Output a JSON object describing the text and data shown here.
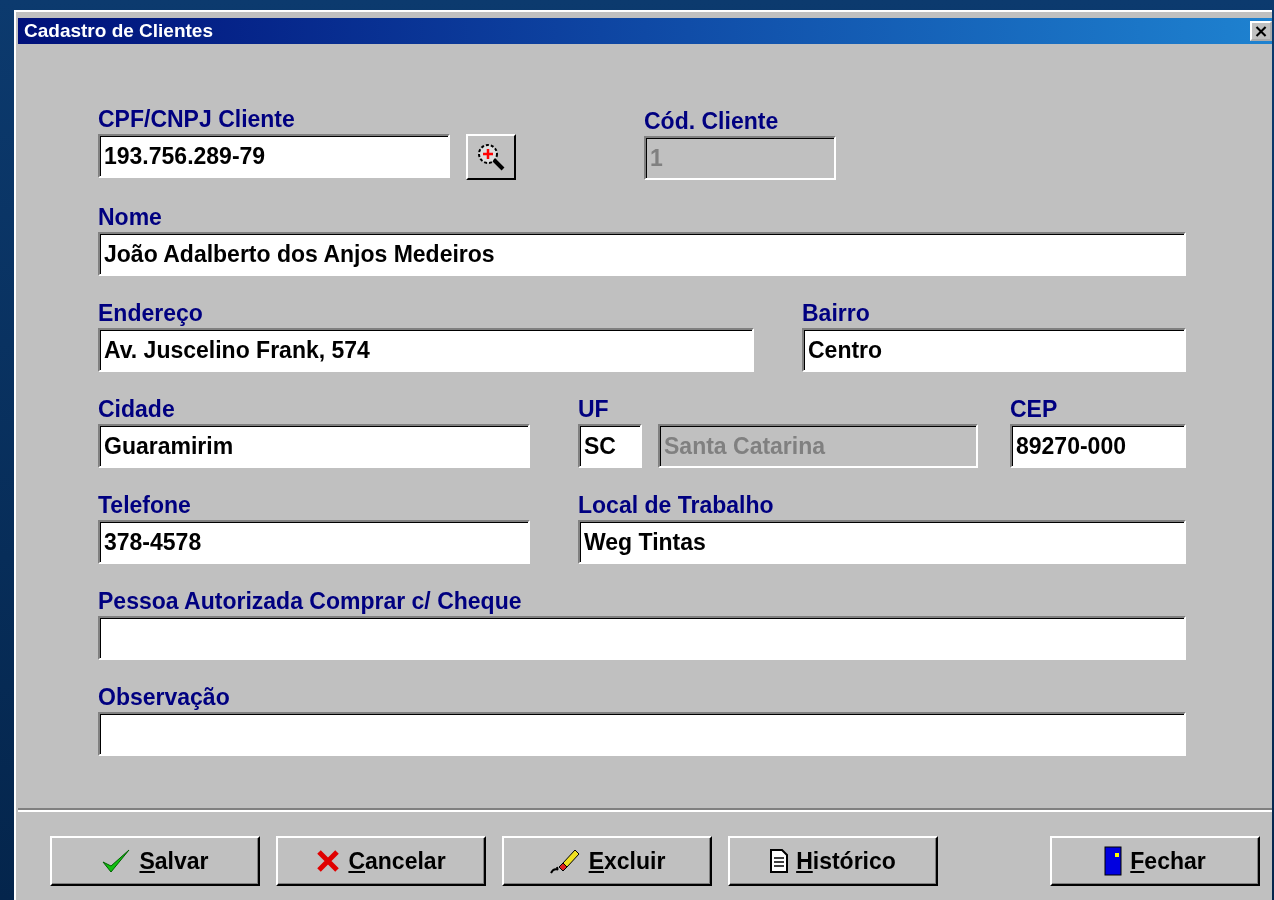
{
  "window": {
    "title": "Cadastro de Clientes",
    "close": "×"
  },
  "rows": [
    [
      {
        "label": "CPF/CNPJ Cliente",
        "value": "193.756.289-79",
        "disabled": false,
        "search_button": true
      },
      {
        "label": "Cód. Cliente",
        "value": "1",
        "disabled": true
      }
    ],
    [
      {
        "label": "Nome",
        "value": "João Adalberto dos Anjos Medeiros",
        "disabled": false
      }
    ],
    [
      {
        "label": "Endereço",
        "value": "Av. Juscelino Frank, 574",
        "disabled": false
      },
      {
        "label": "Bairro",
        "value": "Centro",
        "disabled": false
      }
    ],
    [
      {
        "label": "Cidade",
        "value": "Guaramirim",
        "disabled": false
      },
      {
        "label": "UF",
        "value": "SC",
        "disabled": false
      },
      {
        "value": "Santa Catarina",
        "disabled": true
      },
      {
        "label": "CEP",
        "value": "89270-000",
        "disabled": false
      }
    ],
    [
      {
        "label": "Telefone",
        "value": "378-4578",
        "disabled": false
      },
      {
        "label": "Local de Trabalho",
        "value": "Weg Tintas",
        "disabled": false
      }
    ],
    [
      {
        "label": "Pessoa Autorizada Comprar c/ Cheque",
        "disabled": false
      }
    ],
    [
      {
        "label": "Observação",
        "disabled": false
      }
    ]
  ],
  "buttons": [
    {
      "kind": "save",
      "mnemonic": "S",
      "rest": "alvar"
    },
    {
      "kind": "cancel",
      "mnemonic": "C",
      "rest": "ancelar"
    },
    {
      "kind": "delete",
      "mnemonic": "E",
      "rest": "xcluir"
    },
    {
      "kind": "history",
      "mnemonic": "H",
      "rest": "istórico"
    },
    {
      "kind": "close",
      "mnemonic": "F",
      "rest": "echar"
    }
  ]
}
